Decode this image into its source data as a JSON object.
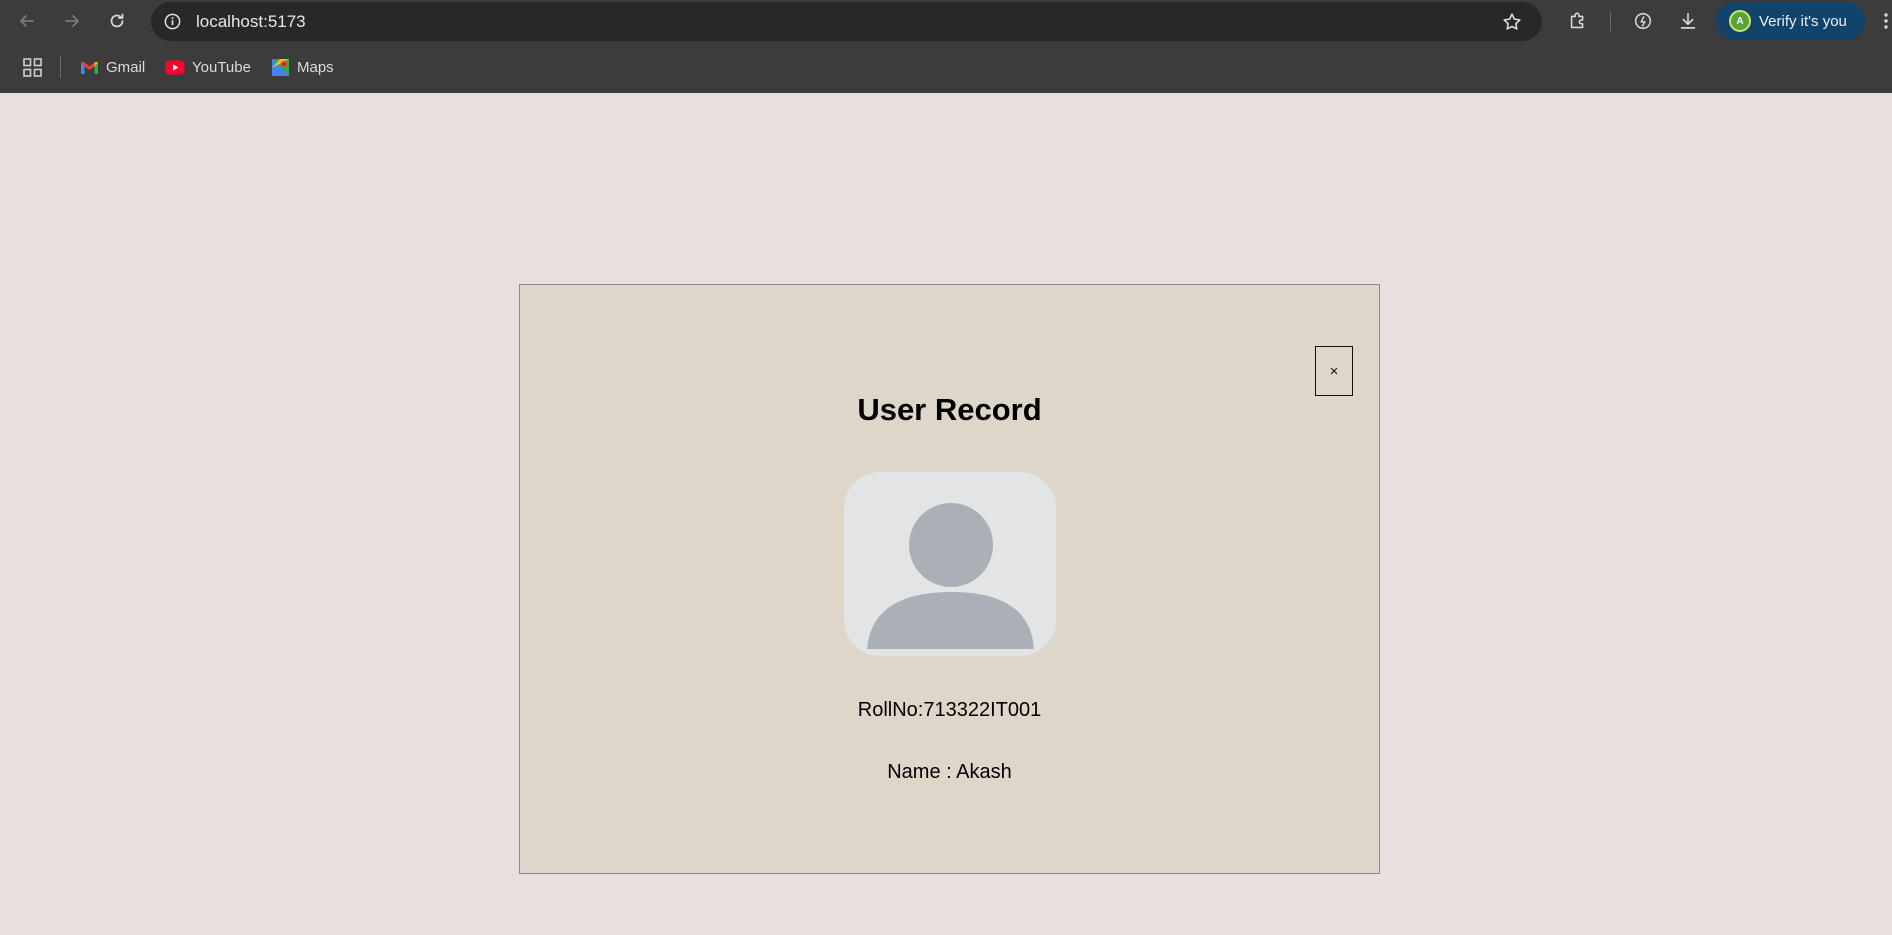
{
  "browser": {
    "url": "localhost:5173",
    "verify_label": "Verify it's you",
    "profile_initial": "A",
    "bookmarks": [
      {
        "label": "Gmail",
        "icon": "gmail-icon"
      },
      {
        "label": "YouTube",
        "icon": "youtube-icon"
      },
      {
        "label": "Maps",
        "icon": "maps-icon"
      }
    ],
    "colors": {
      "chrome": "#3c3c3c",
      "omnibox": "#282828",
      "verify_bg": "#12446b"
    }
  },
  "page": {
    "background": "#e8e0df",
    "card": {
      "title": "User Record",
      "close_label": "×",
      "avatar_icon": "user-avatar-placeholder",
      "roll_no": "RollNo:713322IT001",
      "name": "Name : Akash",
      "background": "#dfd6ca"
    }
  }
}
